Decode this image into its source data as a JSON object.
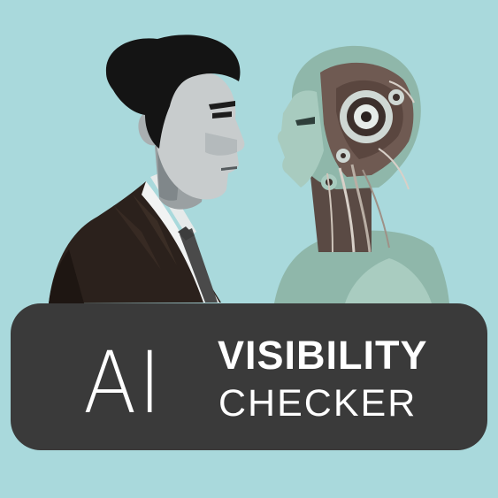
{
  "logo": {
    "ai_text": "AI",
    "line1": "VISIBILITY",
    "line2": "CHECKER"
  },
  "colors": {
    "background": "#a9d9dc",
    "banner": "#3a3a3a",
    "text": "#ffffff",
    "suit": "#2b211c",
    "robot_shell": "#8fb7aa"
  }
}
